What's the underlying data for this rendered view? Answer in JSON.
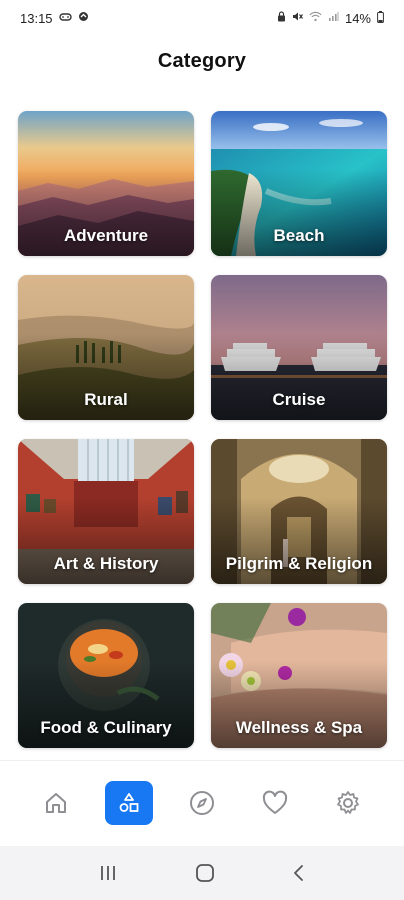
{
  "status_bar": {
    "time": "13:15",
    "battery": "14%",
    "icons": [
      "game-controller-icon",
      "sync-icon",
      "lock-icon",
      "mute-icon",
      "wifi-icon",
      "signal-icon",
      "battery-icon"
    ]
  },
  "header": {
    "title": "Category"
  },
  "categories": [
    {
      "label": "Adventure",
      "icon": "mountains-sunset"
    },
    {
      "label": "Beach",
      "icon": "tropical-beach"
    },
    {
      "label": "Rural",
      "icon": "countryside-hills"
    },
    {
      "label": "Cruise",
      "icon": "cruise-ships"
    },
    {
      "label": "Art & History",
      "icon": "museum-gallery"
    },
    {
      "label": "Pilgrim & Religion",
      "icon": "cathedral-interior"
    },
    {
      "label": "Food & Culinary",
      "icon": "soup-bowl"
    },
    {
      "label": "Wellness & Spa",
      "icon": "spa-flowers"
    }
  ],
  "bottom_nav": {
    "items": [
      "home-icon",
      "category-icon",
      "compass-icon",
      "heart-icon",
      "settings-icon"
    ],
    "active_index": 1,
    "accent": "#1877f2"
  },
  "system_nav": {
    "items": [
      "recents-icon",
      "home-circle-icon",
      "back-icon"
    ]
  }
}
